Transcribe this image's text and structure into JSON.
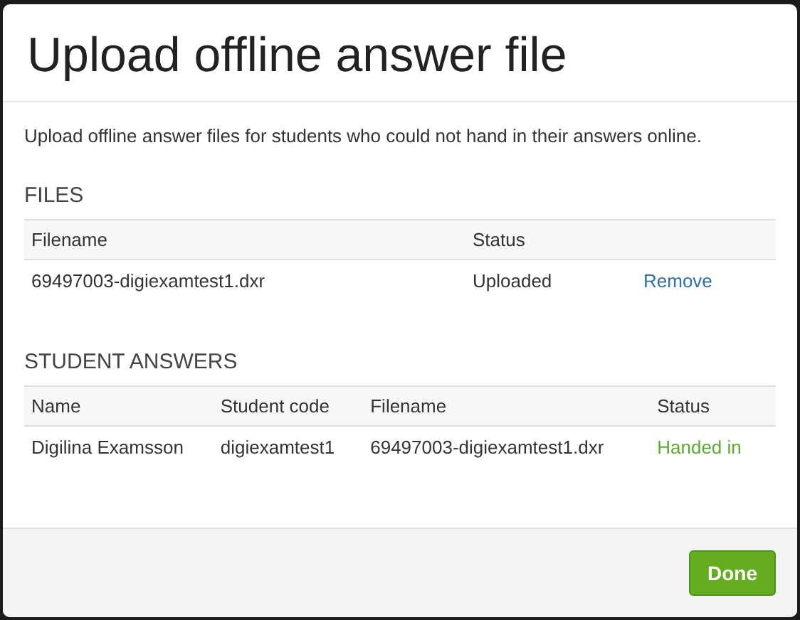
{
  "dialog": {
    "title": "Upload offline answer file",
    "description": "Upload offline answer files for students who could not hand in their answers online.",
    "files": {
      "heading": "FILES",
      "columns": [
        "Filename",
        "Status"
      ],
      "rows": [
        {
          "filename": "69497003-digiexamtest1.dxr",
          "status": "Uploaded",
          "color": "#333333",
          "action": "Remove"
        }
      ]
    },
    "student_answers": {
      "heading": "STUDENT ANSWERS",
      "columns": [
        "Name",
        "Student code",
        "Filename",
        "Status"
      ],
      "rows": [
        {
          "name": "Digilina Examsson",
          "student_code": "digiexamtest1",
          "filename": "69497003-digiexamtest1.dxr",
          "status": "Handed in",
          "color": "#5aab2f"
        }
      ]
    },
    "buttons": [
      "Done"
    ]
  }
}
